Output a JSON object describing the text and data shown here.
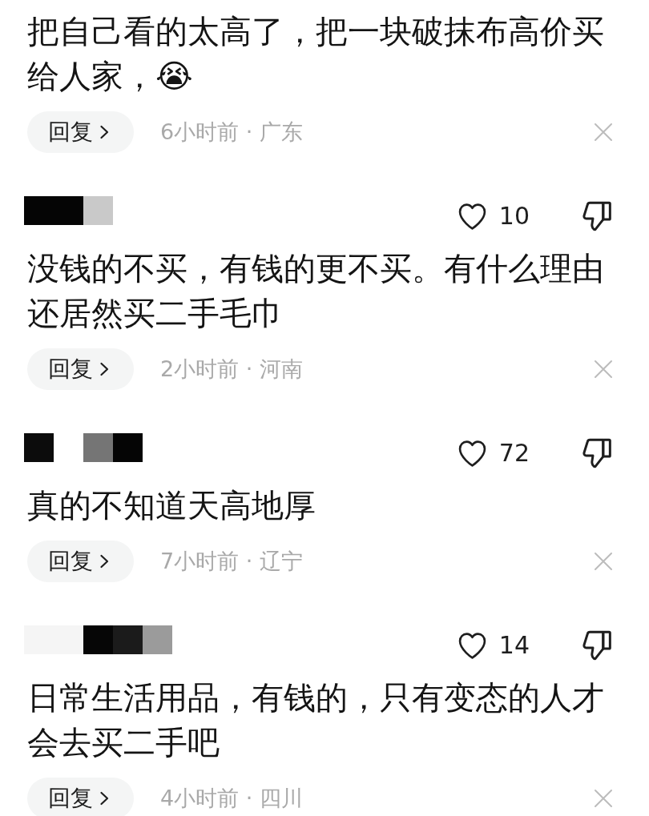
{
  "comments": [
    {
      "text": "把自己看的太高了，把一块破抹布高价买给人家，😭",
      "reply_label": "回复",
      "meta": "6小时前 · 广东"
    },
    {
      "header": {
        "author_redacted": true,
        "likes": "10",
        "liked": false,
        "disliked": false
      },
      "text": "没钱的不买，有钱的更不买。有什么理由还居然买二手毛巾",
      "reply_label": "回复",
      "meta": "2小时前 · 河南"
    },
    {
      "header": {
        "author_redacted": true,
        "likes": "72",
        "liked": false,
        "disliked": false
      },
      "text": "真的不知道天高地厚",
      "reply_label": "回复",
      "meta": "7小时前 · 辽宁"
    },
    {
      "header": {
        "author_redacted": true,
        "likes": "14",
        "liked": false,
        "disliked": false
      },
      "text": "日常生活用品，有钱的，只有变态的人才会去买二手吧",
      "reply_label": "回复",
      "meta": "4小时前 · 四川"
    }
  ]
}
